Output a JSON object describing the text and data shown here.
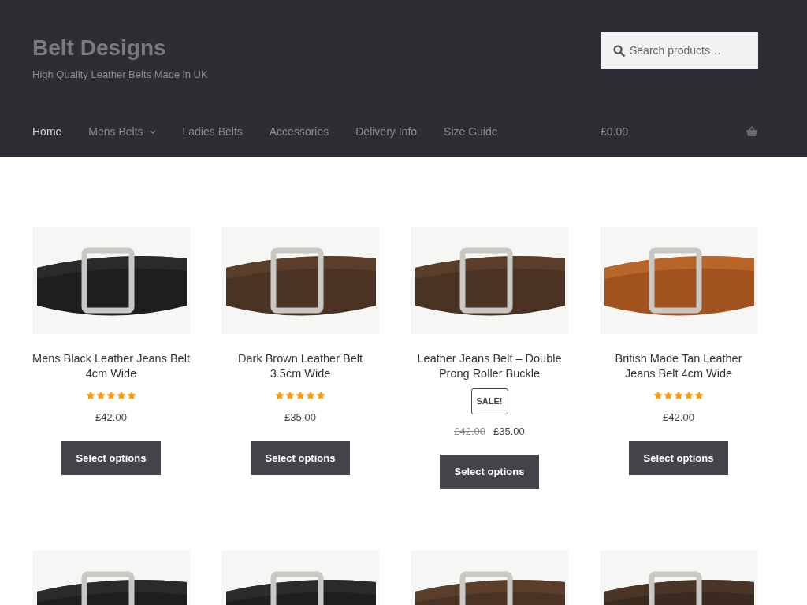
{
  "site": {
    "title": "Belt Designs",
    "tagline": "High Quality Leather Belts Made in UK"
  },
  "search": {
    "placeholder": "Search products…"
  },
  "nav": [
    {
      "label": "Home",
      "selected": true,
      "dropdown": false
    },
    {
      "label": "Mens Belts",
      "selected": false,
      "dropdown": true
    },
    {
      "label": "Ladies Belts",
      "selected": false,
      "dropdown": false
    },
    {
      "label": "Accessories",
      "selected": false,
      "dropdown": false
    },
    {
      "label": "Delivery Info",
      "selected": false,
      "dropdown": false
    },
    {
      "label": "Size Guide",
      "selected": false,
      "dropdown": false
    }
  ],
  "cart": {
    "total": "£0.00"
  },
  "products": [
    {
      "kind": "full",
      "name": "Mens Black Leather Jeans Belt 4cm Wide",
      "stars": 5,
      "sale": false,
      "price": "£42.00",
      "button": "Select options"
    },
    {
      "kind": "full",
      "name": "Dark Brown Leather Belt 3.5cm Wide",
      "stars": 5,
      "sale": false,
      "price": "£35.00",
      "button": "Select options"
    },
    {
      "kind": "full",
      "name": "Leather Jeans Belt – Double Prong Roller Buckle",
      "sale": true,
      "badge": "SALE!",
      "old_price": "£42.00",
      "price": "£35.00",
      "button": "Select options"
    },
    {
      "kind": "full",
      "name": "British Made Tan Leather Jeans Belt 4cm Wide",
      "stars": 5,
      "sale": false,
      "price": "£42.00",
      "button": "Select options"
    },
    {
      "kind": "photo"
    },
    {
      "kind": "photo"
    },
    {
      "kind": "photo"
    },
    {
      "kind": "photo"
    }
  ]
}
